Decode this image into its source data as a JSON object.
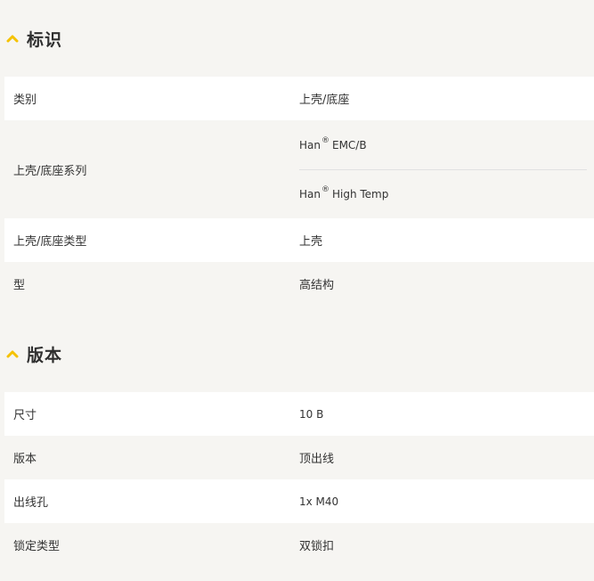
{
  "sections": [
    {
      "title": "标识",
      "rows": [
        {
          "label": "类别",
          "value": "上壳/底座"
        },
        {
          "label": "上壳/底座系列",
          "values": [
            {
              "text": "Han",
              "reg": "®",
              "rest": "EMC/B"
            },
            {
              "text": "Han",
              "reg": "®",
              "rest": "High Temp"
            }
          ]
        },
        {
          "label": "上壳/底座类型",
          "value": "上壳"
        },
        {
          "label": "型",
          "value": "高结构"
        }
      ]
    },
    {
      "title": "版本",
      "rows": [
        {
          "label": "尺寸",
          "value": "10 B"
        },
        {
          "label": "版本",
          "value": "顶出线"
        },
        {
          "label": "出线孔",
          "value": "1x M40"
        },
        {
          "label": "锁定类型",
          "value": "双锁扣"
        }
      ]
    }
  ],
  "colors": {
    "accent_chevron": "#f5c200",
    "row_white": "#ffffff",
    "row_grey": "#f6f5f2",
    "text": "#333333"
  },
  "icons": {
    "section_toggle": "chevron-up-icon"
  }
}
